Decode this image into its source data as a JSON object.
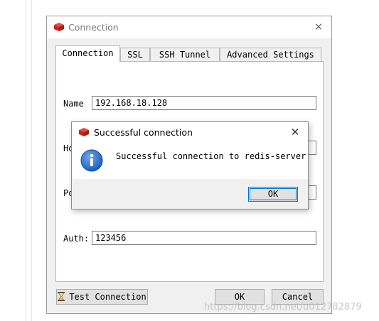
{
  "window": {
    "title": "Connection",
    "close_glyph": "✕",
    "icon": "redis-icon"
  },
  "tabs": [
    {
      "label": "Connection",
      "active": true
    },
    {
      "label": "SSL",
      "active": false
    },
    {
      "label": "SSH Tunnel",
      "active": false
    },
    {
      "label": "Advanced Settings",
      "active": false
    }
  ],
  "form": {
    "name_label": "Name",
    "name_value": "192.168.18.128",
    "host_label": "Ho",
    "port_label": "Po",
    "auth_label": "Auth:",
    "auth_value": "123456"
  },
  "buttons": {
    "test_connection": "Test Connection",
    "ok": "OK",
    "cancel": "Cancel"
  },
  "dialog": {
    "title": "Successful connection",
    "message": "Successful connection to redis-server",
    "ok": "OK",
    "close_glyph": "✕",
    "icon": "info-icon"
  },
  "watermark": "https://blog.csdn.net/u012782879",
  "colors": {
    "redis_red": "#d82c20",
    "info_blue": "#1a5fbf",
    "focus_blue": "#0078d7"
  }
}
